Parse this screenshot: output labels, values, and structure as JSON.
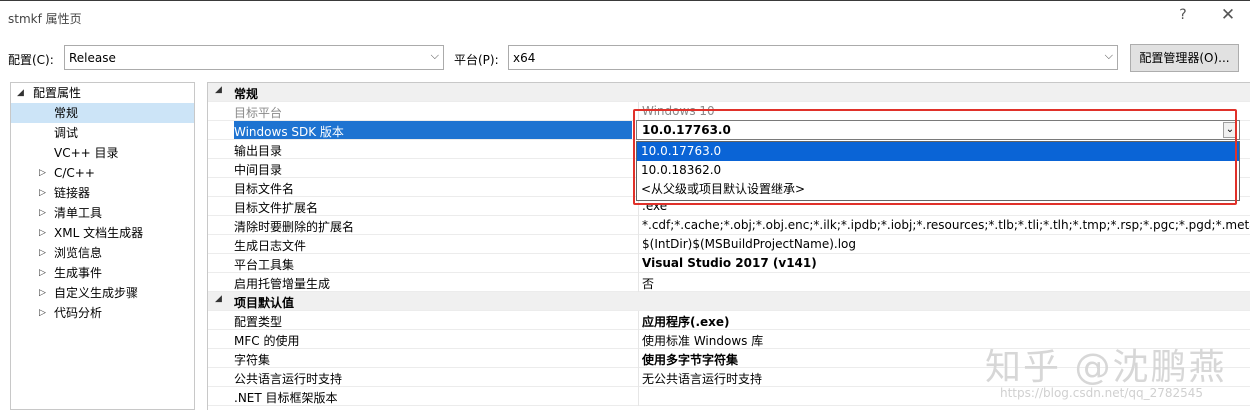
{
  "window": {
    "title": "stmkf 属性页",
    "help": "?",
    "close": "✕"
  },
  "toolbar": {
    "config_label": "配置(C):",
    "config_value": "Release",
    "platform_label": "平台(P):",
    "platform_value": "x64",
    "manager_button": "配置管理器(O)..."
  },
  "tree": {
    "root": "配置属性",
    "items": [
      {
        "label": "常规",
        "selected": true
      },
      {
        "label": "调试"
      },
      {
        "label": "VC++ 目录"
      },
      {
        "label": "C/C++",
        "expandable": true
      },
      {
        "label": "链接器",
        "expandable": true
      },
      {
        "label": "清单工具",
        "expandable": true
      },
      {
        "label": "XML 文档生成器",
        "expandable": true
      },
      {
        "label": "浏览信息",
        "expandable": true
      },
      {
        "label": "生成事件",
        "expandable": true
      },
      {
        "label": "自定义生成步骤",
        "expandable": true
      },
      {
        "label": "代码分析",
        "expandable": true
      }
    ]
  },
  "grid": {
    "section1": "常规",
    "rows1": [
      {
        "key": "目标平台",
        "value": "Windows 10"
      },
      {
        "key": "Windows SDK 版本",
        "value": ""
      },
      {
        "key": "输出目录",
        "value": ""
      },
      {
        "key": "中间目录",
        "value": ""
      },
      {
        "key": "目标文件名",
        "value": ""
      },
      {
        "key": "目标文件扩展名",
        "value": ".exe"
      },
      {
        "key": "清除时要删除的扩展名",
        "value": "*.cdf;*.cache;*.obj;*.obj.enc;*.ilk;*.ipdb;*.iobj;*.resources;*.tlb;*.tli;*.tlh;*.tmp;*.rsp;*.pgc;*.pgd;*.meta;*.tlog;"
      },
      {
        "key": "生成日志文件",
        "value": "$(IntDir)$(MSBuildProjectName).log"
      },
      {
        "key": "平台工具集",
        "value": "Visual Studio 2017 (v141)"
      },
      {
        "key": "启用托管增量生成",
        "value": "否"
      }
    ],
    "section2": "项目默认值",
    "rows2": [
      {
        "key": "配置类型",
        "value": "应用程序(.exe)"
      },
      {
        "key": "MFC 的使用",
        "value": "使用标准 Windows 库"
      },
      {
        "key": "字符集",
        "value": "使用多字节字符集"
      },
      {
        "key": "公共语言运行时支持",
        "value": "无公共语言运行时支持"
      },
      {
        "key": ".NET 目标框架版本",
        "value": ""
      }
    ]
  },
  "sdk_dropdown": {
    "current": "10.0.17763.0",
    "options": [
      "10.0.17763.0",
      "10.0.18362.0",
      "<从父级或项目默认设置继承>"
    ]
  },
  "watermark": {
    "main": "知乎 @沈鹏燕",
    "url": "https://blog.csdn.net/qq_2782545"
  },
  "colors": {
    "selection": "#1e73d1",
    "highlight_box": "#e0312a"
  }
}
